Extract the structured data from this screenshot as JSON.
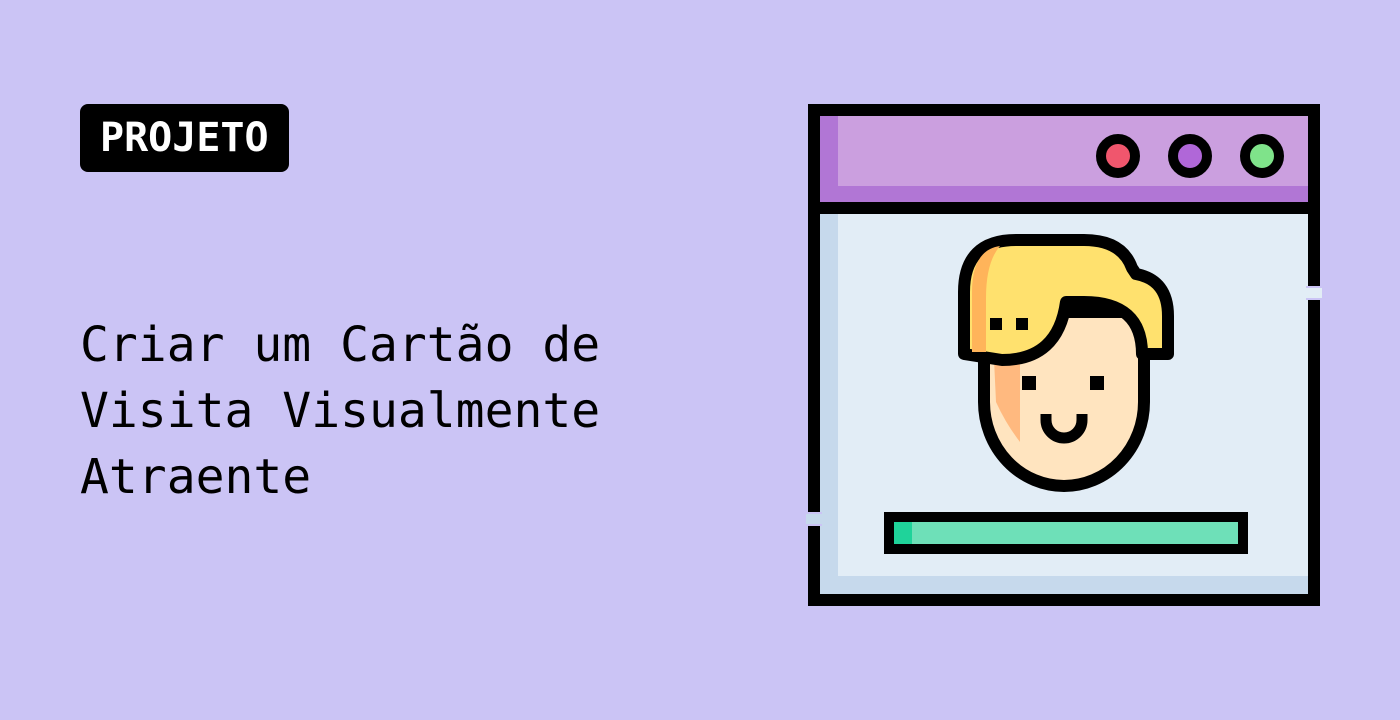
{
  "colors": {
    "background": "#cbc4f5",
    "badge_bg": "#000000",
    "badge_text": "#ffffff",
    "title_text": "#000000",
    "window_titlebar": "#cb9fdf",
    "window_titlebar_shade": "#b176d5",
    "window_body": "#e2edf6",
    "window_body_shade": "#c6d9ec",
    "dot_red": "#f0566d",
    "dot_purple": "#b067d8",
    "dot_green": "#7fe38a",
    "hair": "#ffe16e",
    "hair_shade": "#ffb45a",
    "face": "#ffe4bf",
    "face_shade": "#ffb97f",
    "bar_fill": "#6ee0b8",
    "bar_accent": "#1fd39a",
    "outline": "#000000"
  },
  "badge": {
    "label": "PROJETO"
  },
  "title": {
    "lines": [
      "Criar um Cartão de",
      "Visita Visualmente",
      "Atraente"
    ]
  },
  "illustration": {
    "icon": "profile-window-icon",
    "window_buttons": [
      "red-dot-icon",
      "purple-dot-icon",
      "green-dot-icon"
    ]
  }
}
